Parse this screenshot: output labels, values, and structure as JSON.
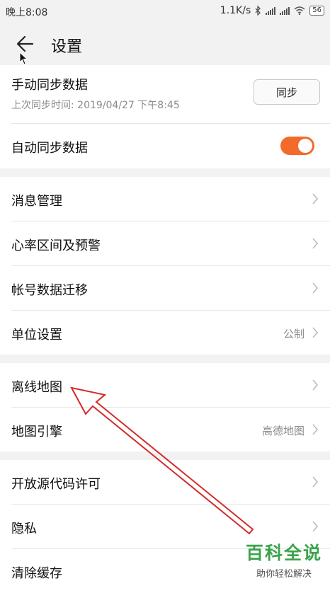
{
  "status_bar": {
    "time": "晚上8:08",
    "network_speed": "1.1K/s",
    "battery": "56"
  },
  "header": {
    "title": "设置"
  },
  "sync": {
    "manual_label": "手动同步数据",
    "last_sync": "上次同步时间: 2019/04/27 下午8:45",
    "sync_button": "同步",
    "auto_label": "自动同步数据",
    "auto_enabled": true
  },
  "items": [
    {
      "label": "消息管理"
    },
    {
      "label": "心率区间及预警"
    },
    {
      "label": "帐号数据迁移"
    },
    {
      "label": "单位设置",
      "value": "公制"
    },
    {
      "label": "离线地图"
    },
    {
      "label": "地图引擎",
      "value": "高德地图"
    },
    {
      "label": "开放源代码许可"
    },
    {
      "label": "隐私"
    },
    {
      "label": "清除缓存"
    }
  ],
  "watermark": {
    "main": "百科全说",
    "sub": "助你轻松解决"
  },
  "colors": {
    "accent": "#f26b2a",
    "annotation_arrow": "#d42a2a",
    "watermark": "#3aa34a"
  }
}
